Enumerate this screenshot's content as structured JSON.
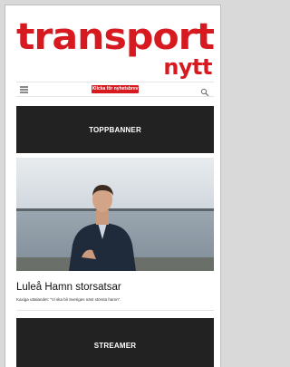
{
  "brand": {
    "name": "transport",
    "sub": "nytt",
    "color": "#d71920"
  },
  "navbar": {
    "menu_icon": "hamburger-icon",
    "newsletter_label": "Klicka för nyhetsbrev",
    "search_icon": "search-icon"
  },
  "ads": {
    "top_banner": "TOPPBANNER",
    "streamer": "STREAMER",
    "background": "#222222"
  },
  "article": {
    "headline": "Luleå Hamn storsatsar",
    "lead": "Kaxiga uttalandet: \"Vi ska bli Sveriges näst största hamn\"."
  }
}
